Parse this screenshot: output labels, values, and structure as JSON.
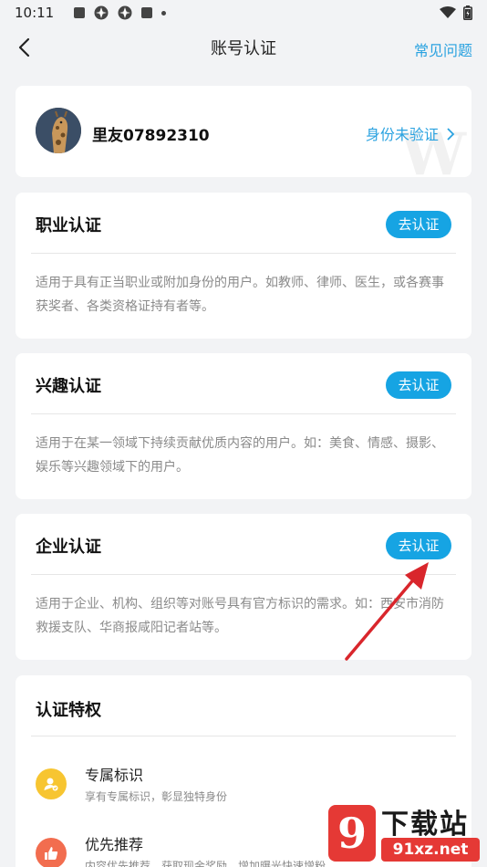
{
  "status_bar": {
    "time": "10:11"
  },
  "nav": {
    "title": "账号认证",
    "faq": "常见问题"
  },
  "user": {
    "name": "里友07892310",
    "verify_status": "身份未验证"
  },
  "certifications": [
    {
      "title": "职业认证",
      "button": "去认证",
      "desc": "适用于具有正当职业或附加身份的用户。如教师、律师、医生，或各赛事获奖者、各类资格证持有者等。"
    },
    {
      "title": "兴趣认证",
      "button": "去认证",
      "desc": "适用于在某一领域下持续贡献优质内容的用户。如：美食、情感、摄影、娱乐等兴趣领域下的用户。"
    },
    {
      "title": "企业认证",
      "button": "去认证",
      "desc": "适用于企业、机构、组织等对账号具有官方标识的需求。如：西安市消防救援支队、华商报咸阳记者站等。"
    }
  ],
  "privileges": {
    "title": "认证特权",
    "items": [
      {
        "name": "专属标识",
        "desc": "享有专属标识，彰显独特身份",
        "icon": "user-badge-icon",
        "color": "#f7c531"
      },
      {
        "name": "优先推荐",
        "desc": "内容优先推荐，获取现金奖励，增加曝光快速增粉",
        "icon": "thumbs-up-icon",
        "color": "#f26d4f"
      }
    ]
  },
  "watermark": {
    "logo": "9",
    "text": "下载站",
    "url": "91xz.net"
  },
  "colors": {
    "accent": "#16a4e3",
    "link": "#2aa2e0",
    "annotation": "#d9262c"
  }
}
